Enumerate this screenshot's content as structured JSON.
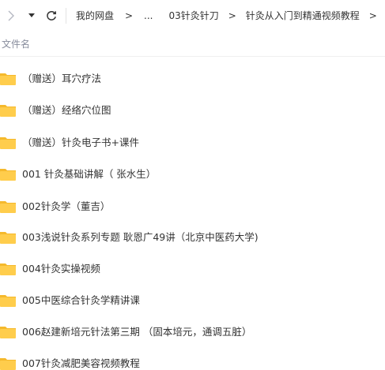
{
  "navbar": {
    "forward_icon": "chevron-right-icon",
    "dropdown_icon": "caret-down-icon",
    "refresh_icon": "refresh-icon",
    "breadcrumbs": [
      "我的网盘",
      "...",
      "03针灸针刀",
      "针灸从入门到精通视频教程"
    ],
    "separator": ">"
  },
  "header": {
    "name_column": "文件名"
  },
  "colors": {
    "folder": "#ffcd4c",
    "folder_tab": "#f5b92c",
    "text": "#333333",
    "muted": "#878c9c"
  },
  "files": [
    {
      "name": "（赠送）耳穴疗法",
      "icon": "folder-icon"
    },
    {
      "name": "（赠送）经络穴位图",
      "icon": "folder-icon"
    },
    {
      "name": "（赠送）针灸电子书+课件",
      "icon": "folder-icon"
    },
    {
      "name": "001 针灸基础讲解（ 张水生）",
      "icon": "folder-icon"
    },
    {
      "name": "002针灸学（董吉）",
      "icon": "folder-icon"
    },
    {
      "name": "003浅说针灸系列专题 耿恩广49讲（北京中医药大学)",
      "icon": "folder-icon"
    },
    {
      "name": "004针灸实操视频",
      "icon": "folder-icon"
    },
    {
      "name": "005中医综合针灸学精讲课",
      "icon": "folder-icon"
    },
    {
      "name": "006赵建新培元针法第三期 （固本培元，通调五脏）",
      "icon": "folder-icon"
    },
    {
      "name": "007针灸减肥美容视频教程",
      "icon": "folder-icon"
    }
  ]
}
